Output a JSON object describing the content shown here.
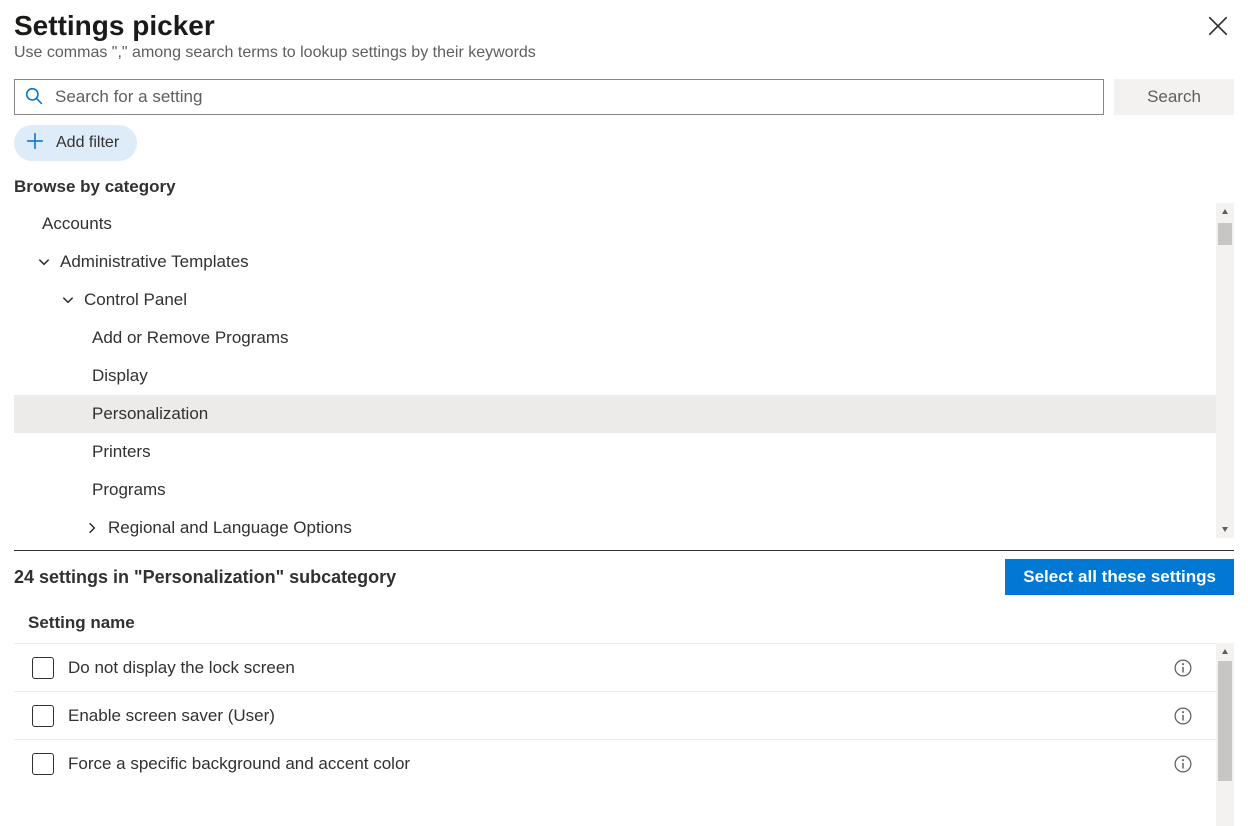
{
  "header": {
    "title": "Settings picker",
    "subtitle": "Use commas \",\" among search terms to lookup settings by their keywords"
  },
  "search": {
    "placeholder": "Search for a setting",
    "button": "Search"
  },
  "filter": {
    "add_label": "Add filter"
  },
  "browse": {
    "label": "Browse by category"
  },
  "tree": {
    "items": [
      {
        "label": "Accounts",
        "indent": "ind-0",
        "chev": "none",
        "selected": false
      },
      {
        "label": "Administrative Templates",
        "indent": "ind-0c",
        "chev": "down",
        "selected": false
      },
      {
        "label": "Control Panel",
        "indent": "ind-1c",
        "chev": "down",
        "selected": false
      },
      {
        "label": "Add or Remove Programs",
        "indent": "ind-2",
        "chev": "none",
        "selected": false
      },
      {
        "label": "Display",
        "indent": "ind-2",
        "chev": "none",
        "selected": false
      },
      {
        "label": "Personalization",
        "indent": "ind-2",
        "chev": "none",
        "selected": true
      },
      {
        "label": "Printers",
        "indent": "ind-2",
        "chev": "none",
        "selected": false
      },
      {
        "label": "Programs",
        "indent": "ind-2",
        "chev": "none",
        "selected": false
      },
      {
        "label": "Regional and Language Options",
        "indent": "ind-2c",
        "chev": "right",
        "selected": false
      }
    ]
  },
  "results": {
    "count_label": "24 settings in \"Personalization\" subcategory",
    "select_all_label": "Select all these settings",
    "column_header": "Setting name",
    "settings": [
      {
        "name": "Do not display the lock screen"
      },
      {
        "name": "Enable screen saver (User)"
      },
      {
        "name": "Force a specific background and accent color"
      }
    ]
  }
}
